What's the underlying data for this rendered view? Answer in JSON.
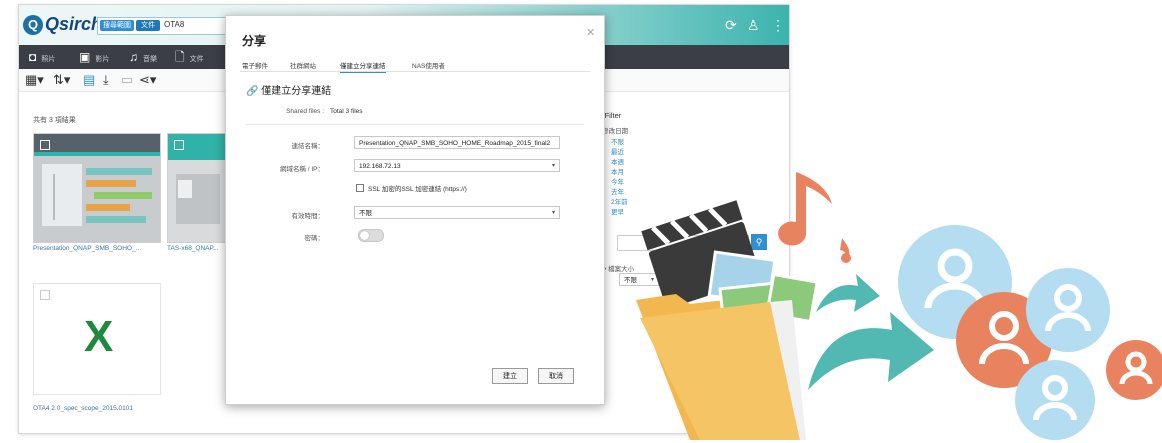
{
  "app": {
    "logo": "Qsirch",
    "search": {
      "chips": [
        "搜尋範圍",
        "文件"
      ],
      "query": "OTA8"
    }
  },
  "navbar": {
    "items": [
      {
        "icon": "camera-icon",
        "label": "照片"
      },
      {
        "icon": "video-icon",
        "label": "影片"
      },
      {
        "icon": "music-icon",
        "label": "音樂"
      },
      {
        "icon": "document-icon",
        "label": "文件"
      }
    ]
  },
  "results": {
    "section_title": "共有 3 項結果",
    "items": [
      {
        "caption": "Presentation_QNAP_SMB_SOHO_..."
      },
      {
        "caption": "TAS-x68_QNAP..."
      },
      {
        "caption": "OTA4 2.0_spec_scope_2015.0101"
      }
    ]
  },
  "filter": {
    "title": "Filter",
    "group1": "修改日期",
    "options": [
      "不限",
      "最近",
      "本週",
      "本月",
      "今年",
      "去年",
      "2年前",
      "更早"
    ],
    "group2": "檔案大小",
    "size_select": "不限"
  },
  "dialog": {
    "title": "分享",
    "tabs": [
      "電子郵件",
      "社群網站",
      "僅建立分享連結",
      "NAS使用者"
    ],
    "active_tab": 2,
    "section_title": "僅建立分享連結",
    "shared_files_label": "Shared files :",
    "shared_files_value": "Total 3 files",
    "link_name_label": "連結名稱：",
    "link_name_value": "Presentation_QNAP_SMB_SOHO_HOME_Roadmap_2015_final2",
    "domain_label": "網域名稱 / IP：",
    "domain_value": "192.168.72.13",
    "ssl_label": "SSL 加密的SSL 加密連結 (https://)",
    "expire_label": "有效時間：",
    "expire_value": "不限",
    "password_label": "密碼：",
    "create_button": "建立",
    "cancel_button": "取消"
  },
  "colors": {
    "accent": "#2f8fd1",
    "navbar": "#3b3f45",
    "header_teal": "#3cb3ad",
    "folder": "#f5c565",
    "people_blue": "#b4ddf2",
    "people_orange": "#e9835f",
    "arrow_teal": "#52b8b2"
  }
}
